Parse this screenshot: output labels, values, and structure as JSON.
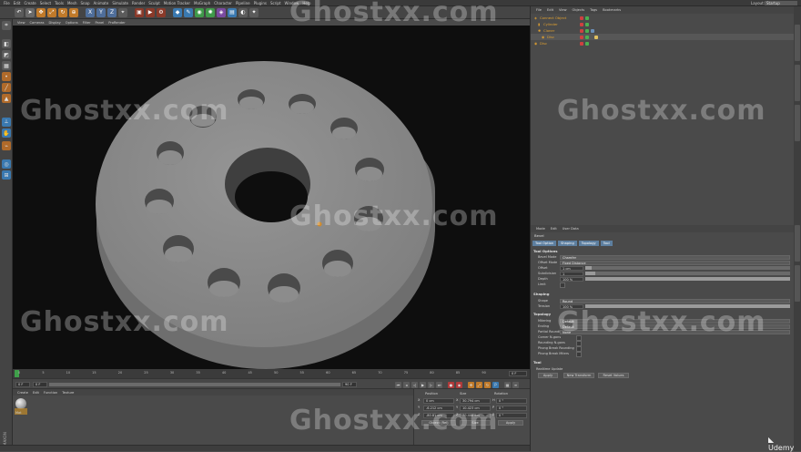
{
  "menubar": {
    "items": [
      "File",
      "Edit",
      "Create",
      "Select",
      "Tools",
      "Mesh",
      "Snap",
      "Animate",
      "Simulate",
      "Render",
      "Sculpt",
      "Motion Tracker",
      "MoGraph",
      "Character",
      "Pipeline",
      "Plugins",
      "Script",
      "Window",
      "Help"
    ],
    "layout_label": "Layout:",
    "layout_value": "Startup"
  },
  "viewport": {
    "menu": [
      "View",
      "Cameras",
      "Display",
      "Options",
      "Filter",
      "Panel",
      "ProRender"
    ]
  },
  "timeline": {
    "ticks": [
      "0",
      "5",
      "10",
      "15",
      "20",
      "25",
      "30",
      "35",
      "40",
      "45",
      "50",
      "55",
      "60",
      "65",
      "70",
      "75",
      "80",
      "85",
      "90"
    ],
    "frame_badge": "0 F",
    "start_field": "0 F",
    "current_field": "0 F",
    "end_field": "90 F"
  },
  "material_panel": {
    "menu": [
      "Create",
      "Edit",
      "Function",
      "Texture"
    ],
    "material_name": "Mat"
  },
  "coordinates": {
    "headers": [
      "Position",
      "Size",
      "Rotation"
    ],
    "rows": [
      {
        "axis": "X",
        "position": "0 cm",
        "size_axis": "X",
        "size": "30.794 cm",
        "rot_axis": "H",
        "rotation": "0 °"
      },
      {
        "axis": "Y",
        "position": "-6.212 cm",
        "size_axis": "Y",
        "size": "10.423 cm",
        "rot_axis": "P",
        "rotation": "0 °"
      },
      {
        "axis": "Z",
        "position": "-80.81 cm",
        "size_axis": "Z",
        "size": "70.444 cm",
        "rot_axis": "B",
        "rotation": "0 °"
      }
    ],
    "mode_select": "Object (Rel)",
    "size_select": "Size",
    "apply_button": "Apply"
  },
  "objects": {
    "menu": [
      "File",
      "Edit",
      "View",
      "Objects",
      "Tags",
      "Bookmarks"
    ],
    "items": [
      {
        "name": "Connect Object",
        "indent": 0,
        "color": "#e0a030"
      },
      {
        "name": "Cylinder",
        "indent": 1,
        "color": "#e0a030"
      },
      {
        "name": "Cloner",
        "indent": 1,
        "color": "#e0a030"
      },
      {
        "name": "Disc",
        "indent": 2,
        "color": "#e0a030"
      },
      {
        "name": "Disc",
        "indent": 0,
        "color": "#e0a030"
      }
    ]
  },
  "attributes": {
    "menu": [
      "Mode",
      "Edit",
      "User Data"
    ],
    "object_label": "Bevel",
    "tabs": [
      "Tool Option",
      "Shaping",
      "Topology",
      "Tool"
    ],
    "sections": {
      "tool_options": "Tool Options",
      "shaping": "Shaping",
      "topology": "Topology",
      "tool": "Tool"
    },
    "tool_options": [
      {
        "label": "Bevel Mode",
        "value": "Chamfer",
        "kind": "dropdown"
      },
      {
        "label": "Offset Mode",
        "value": "Fixed Distance",
        "kind": "dropdown"
      },
      {
        "label": "Offset",
        "value": "1 cm",
        "kind": "slider",
        "fill": 0.03
      },
      {
        "label": "Subdivision",
        "value": "1",
        "kind": "slider",
        "fill": 0.05
      },
      {
        "label": "Depth",
        "value": "100 %",
        "kind": "slider",
        "fill": 1.0
      },
      {
        "label": "Limit",
        "value": "",
        "kind": "check"
      }
    ],
    "shaping": [
      {
        "label": "Shape",
        "value": "Round",
        "kind": "dropdown"
      },
      {
        "label": "Tension",
        "value": "100 %",
        "kind": "slider",
        "fill": 1.0
      }
    ],
    "topology": [
      {
        "label": "Mitering",
        "value": "Default",
        "kind": "dropdown"
      },
      {
        "label": "Ending",
        "value": "Default",
        "kind": "dropdown"
      },
      {
        "label": "Partial Rounding",
        "value": "None",
        "kind": "dropdown"
      },
      {
        "label": "Corner N-gons",
        "value": "",
        "kind": "check"
      },
      {
        "label": "Rounding N-gons",
        "value": "",
        "kind": "check"
      },
      {
        "label": "Phong Break Rounding",
        "value": "",
        "kind": "check"
      },
      {
        "label": "Phong Break Miters",
        "value": "",
        "kind": "check"
      }
    ],
    "tool": {
      "realtime_label": "Realtime Update",
      "apply_button": "Apply",
      "new_transform_button": "New Transform",
      "reset_values_button": "Reset Values"
    }
  },
  "left_side_label": "MAXON",
  "watermark": "Ghostxx.com",
  "udemy": "Udemy",
  "colors": {
    "viewport_bg": "#0e0e0e",
    "model": "#8a8a8a",
    "accent": "#5d7fa0"
  }
}
